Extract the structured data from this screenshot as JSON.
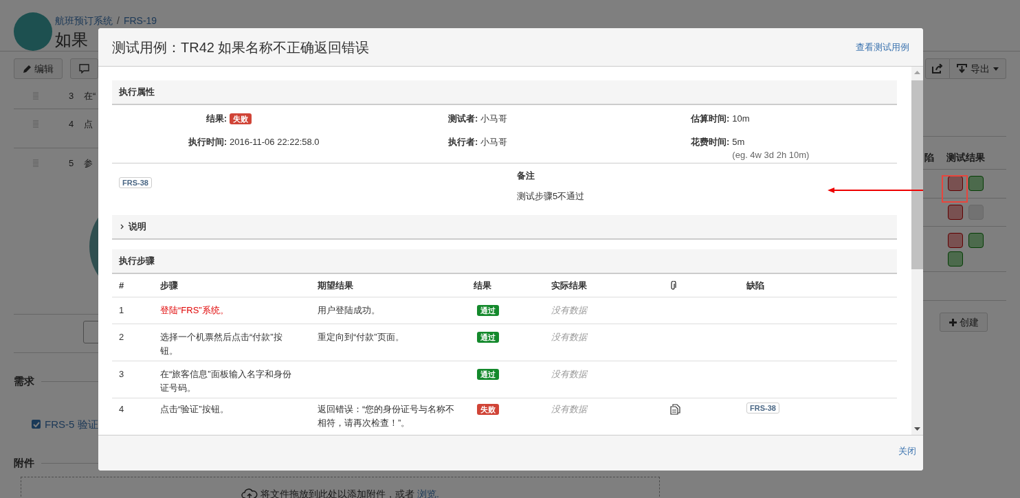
{
  "page": {
    "breadcrumb": [
      {
        "text": "航班预订系统"
      },
      {
        "text": "FRS-19"
      }
    ],
    "breadcrumb_separator": "/",
    "title": "如果",
    "toolbar": [
      {
        "kind": "edit",
        "label": "编辑"
      },
      {
        "kind": "comment"
      }
    ],
    "export_button": "导出",
    "steps": [
      {
        "number": "3",
        "text": "在“"
      },
      {
        "number": "4",
        "text": "点"
      },
      {
        "number": "5",
        "text": "参"
      }
    ],
    "executions": {
      "columns": [
        "陷",
        "测试结果"
      ],
      "rows": [
        {
          "results": [
            {
              "kind": "fail"
            },
            {
              "kind": "pass"
            }
          ]
        },
        {
          "results": [
            {
              "kind": "fail"
            },
            {
              "kind": "none"
            }
          ]
        },
        {
          "results": [
            {
              "kind": "fail"
            },
            {
              "kind": "pass"
            },
            {
              "kind": "pass"
            }
          ]
        }
      ]
    },
    "create_button": "创建",
    "requirements": {
      "heading": "需求",
      "items": [
        {
          "label": "FRS-5 验证",
          "checked": true
        }
      ]
    },
    "attachments": {
      "heading": "附件",
      "dropzone_text": "将文件拖放到此处以添加附件，或者",
      "browse_link": "浏览."
    }
  },
  "dialog": {
    "title": "测试用例：TR42 如果名称不正确返回错误",
    "header_link": "查看测试用例",
    "execution": {
      "heading": "执行属性",
      "columns": [
        {
          "fields": [
            {
              "label": "结果:",
              "kind": "badge",
              "color": "#d04437",
              "value": "失败"
            },
            {
              "label": "执行时间:",
              "kind": "text",
              "value": "2016-11-06 22:22:58.0"
            }
          ]
        },
        {
          "fields": [
            {
              "label": "测试者:",
              "kind": "text",
              "value": "小马哥"
            },
            {
              "label": "执行者:",
              "kind": "text",
              "value": "小马哥"
            }
          ]
        },
        {
          "fields": [
            {
              "label": "估算时间:",
              "kind": "text",
              "value": "10m"
            },
            {
              "label": "花费时间:",
              "kind": "text",
              "value": "5m",
              "hint": "(eg. 4w 3d 2h 10m)"
            }
          ]
        }
      ],
      "defects": [
        "FRS-38"
      ],
      "comment": {
        "heading": "备注",
        "text": "测试步骤5不通过"
      }
    },
    "description": {
      "heading": "说明",
      "expanded": false
    },
    "steps": {
      "heading": "执行步骤",
      "columns": [
        {
          "kind": "text",
          "label": "#"
        },
        {
          "kind": "text",
          "label": "步骤"
        },
        {
          "kind": "text",
          "label": "期望结果"
        },
        {
          "kind": "text",
          "label": "结果"
        },
        {
          "kind": "text",
          "label": "实际结果"
        },
        {
          "kind": "attachment"
        },
        {
          "kind": "text",
          "label": "缺陷"
        }
      ],
      "rows": [
        {
          "number": "1",
          "step": "登陆“FRS”系统。",
          "highlighted": true,
          "expected": "用户登陆成功。",
          "result": {
            "color": "#14892c",
            "label": "通过"
          },
          "actual": "没有数据",
          "attachment": false
        },
        {
          "number": "2",
          "step": "选择一个机票然后点击“付款”按钮。",
          "highlighted": false,
          "expected": "重定向到“付款”页面。",
          "result": {
            "color": "#14892c",
            "label": "通过"
          },
          "actual": "没有数据",
          "attachment": false
        },
        {
          "number": "3",
          "step": "在“旅客信息”面板输入名字和身份证号码。",
          "highlighted": false,
          "result": {
            "color": "#14892c",
            "label": "通过"
          },
          "actual": "没有数据",
          "attachment": false
        },
        {
          "number": "4",
          "step": "点击“验证”按钮。",
          "highlighted": false,
          "expected": "返回错误：“您的身份证号与名称不相符，请再次检查！”。",
          "result": {
            "color": "#d04437",
            "label": "失败"
          },
          "actual": "没有数据",
          "attachment": true,
          "defects": [
            "FRS-38"
          ]
        }
      ]
    },
    "close_link": "关闭"
  }
}
